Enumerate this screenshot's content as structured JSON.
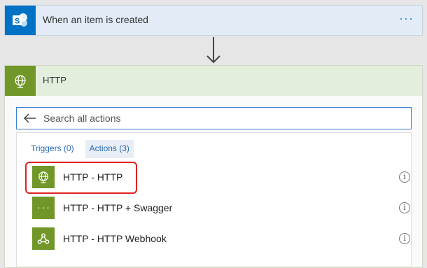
{
  "trigger": {
    "title": "When an item is created",
    "more_label": "···",
    "icon": "sharepoint-icon"
  },
  "http_card": {
    "title": "HTTP",
    "icon": "globe-icon"
  },
  "search": {
    "placeholder": "Search all actions"
  },
  "tabs": [
    {
      "label": "Triggers (0)",
      "active": false
    },
    {
      "label": "Actions (3)",
      "active": true
    }
  ],
  "actions": [
    {
      "label": "HTTP - HTTP",
      "icon": "globe-icon",
      "highlighted": true
    },
    {
      "label": "HTTP - HTTP + Swagger",
      "icon": "swagger-icon",
      "highlighted": false
    },
    {
      "label": "HTTP - HTTP Webhook",
      "icon": "webhook-icon",
      "highlighted": false
    }
  ],
  "colors": {
    "sharepoint_blue": "#0072c6",
    "http_green": "#709727",
    "accent_blue": "#3a7bd5",
    "highlight_red": "#e02020"
  }
}
